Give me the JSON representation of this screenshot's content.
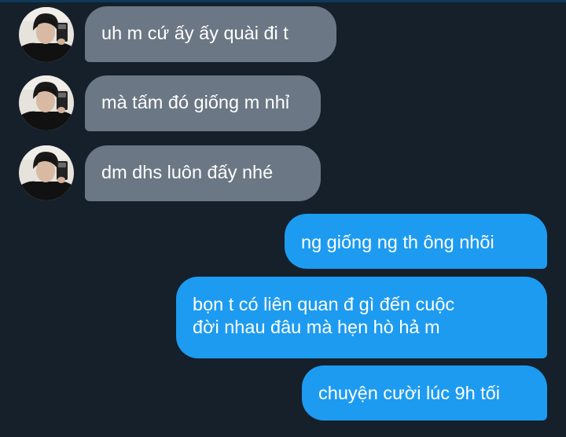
{
  "conversation": {
    "messages": [
      {
        "direction": "incoming",
        "text": "uh m cứ ấy ấy quài đi t",
        "has_avatar": true
      },
      {
        "direction": "incoming",
        "text": "mà tấm đó giống m nhỉ",
        "has_avatar": true
      },
      {
        "direction": "incoming",
        "text": "dm dhs luôn đấy nhé",
        "has_avatar": true
      },
      {
        "direction": "outgoing",
        "text": "ng giống ng th ông nhõi"
      },
      {
        "direction": "outgoing",
        "text_lines": [
          "bọn t có liên quan đ gì đến cuộc",
          "đời nhau đâu mà hẹn hò hả m"
        ]
      },
      {
        "direction": "outgoing",
        "text": "chuyện cười lúc 9h tối"
      }
    ]
  },
  "colors": {
    "background": "#15202b",
    "incoming_bubble": "#6b7784",
    "outgoing_bubble": "#1d9bf0",
    "text": "#ffffff"
  }
}
